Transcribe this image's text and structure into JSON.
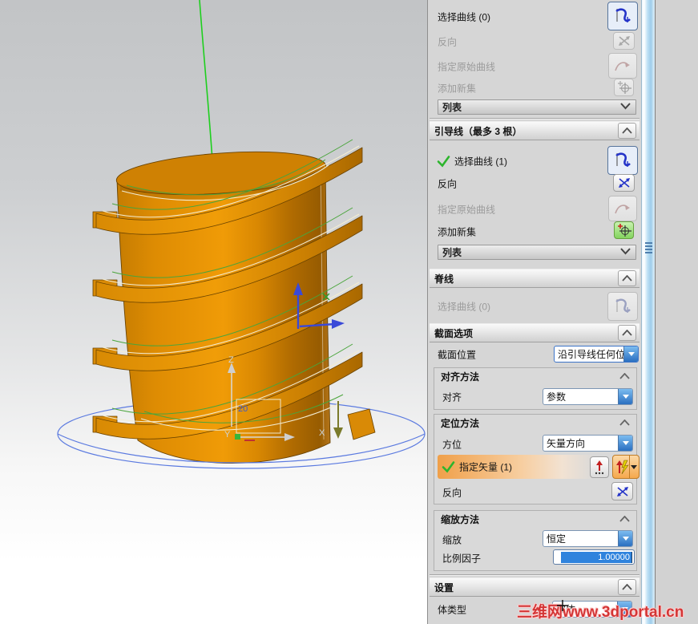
{
  "watermark": "三维网www.3dportal.cn",
  "colors": {
    "model_orange": "#e08a00",
    "helix_green": "#4aa53c",
    "ground_ellipse_blue": "#5b7ae0",
    "vector_arrow_blue": "#3a49d8",
    "axis_green": "#1ecf1e",
    "highlight_orange": "#f0a04a",
    "selection_blue": "#2f83dd",
    "watermark_red": "#d43535",
    "panel_bg": "#d6d6d6"
  },
  "icons": {
    "curve": "curve-select-icon",
    "reverse": "reverse-direction-icon",
    "original_curve": "original-curve-icon",
    "add_set": "add-new-set-icon",
    "vector_dialog": "vector-dialog-icon",
    "vector_constructor": "vector-constructor-icon",
    "check": "check-icon",
    "collapse": "chevron-up-icon",
    "expand": "chevron-down-icon",
    "dropdown": "dropdown-arrow-icon"
  },
  "viewport": {
    "wcs": {
      "z": "Z",
      "y": "Y",
      "x": "X",
      "dim": "20"
    }
  },
  "dialog": {
    "section_curve": {
      "select_curve": "选择曲线 (0)",
      "reverse": "反向",
      "original": "指定原始曲线",
      "add_set": "添加新集",
      "list": "列表"
    },
    "guides": {
      "title": "引导线（最多 3 根）",
      "select_curve": "选择曲线 (1)",
      "reverse": "反向",
      "original": "指定原始曲线",
      "add_set": "添加新集",
      "list": "列表"
    },
    "spine": {
      "title": "脊线",
      "select_curve": "选择曲线 (0)"
    },
    "section_options": {
      "title": "截面选项",
      "position_label": "截面位置",
      "position_value": "沿引导线任何位",
      "align": {
        "title": "对齐方法",
        "label": "对齐",
        "value": "参数"
      },
      "orient": {
        "title": "定位方法",
        "label": "方位",
        "value": "矢量方向",
        "vector": "指定矢量 (1)",
        "reverse": "反向"
      },
      "scale": {
        "title": "缩放方法",
        "label": "缩放",
        "value": "恒定",
        "factor_label": "比例因子",
        "factor_value": "1.00000"
      }
    },
    "settings": {
      "title": "设置",
      "body_type_label": "体类型",
      "body_type_value": "实体"
    }
  }
}
